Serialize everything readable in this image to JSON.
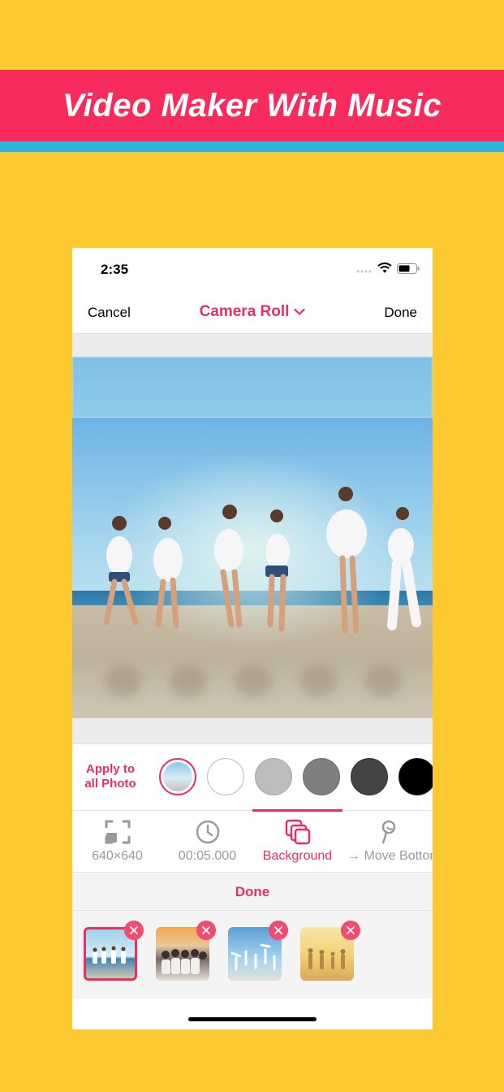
{
  "banner": {
    "title": "Video Maker With Music"
  },
  "status_bar": {
    "time": "2:35",
    "icons": [
      "signal-dots-icon",
      "wifi-icon",
      "battery-icon"
    ]
  },
  "nav": {
    "cancel_label": "Cancel",
    "title": "Camera Roll",
    "done_label": "Done"
  },
  "background_options": {
    "apply_label_line1": "Apply to",
    "apply_label_line2": "all Photo",
    "swatches": [
      "photo-blur",
      "#FFFFFF",
      "#BDBDBD",
      "#7F7F7F",
      "#444444",
      "#000000"
    ],
    "selected": "photo-blur"
  },
  "tools": [
    {
      "label": "640×640",
      "icon": "crop-frame-icon"
    },
    {
      "label": "00:05.000",
      "icon": "clock-icon"
    },
    {
      "label": "Background",
      "icon": "layers-icon",
      "active": true
    },
    {
      "label": "→ Move Botton",
      "icon": "pin-icon"
    }
  ],
  "done_bar": {
    "label": "Done"
  },
  "thumbnails": {
    "count": 4,
    "selected_index": 0
  },
  "colors": {
    "accent": "#E62F63",
    "banner": "#F72B5C",
    "stripe": "#2CB3DE",
    "page_bg": "#FDC930"
  }
}
